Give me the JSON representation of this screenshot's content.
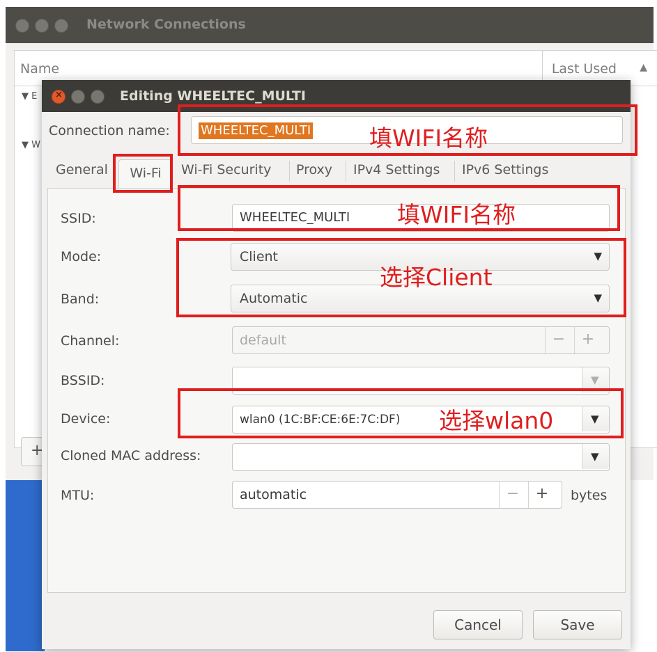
{
  "bg_window": {
    "title": "Network Connections",
    "col_name": "Name",
    "col_last_used": "Last Used",
    "sort_icon": "sort-ascending-icon",
    "group1_initial": "E",
    "group2_initial": "W",
    "add_label": "+"
  },
  "dialog": {
    "title": "Editing WHEELTEC_MULTI",
    "connection_name_label": "Connection name:",
    "connection_name_value": "WHEELTEC_MULTI",
    "tabs": [
      {
        "label": "General"
      },
      {
        "label": "Wi-Fi"
      },
      {
        "label": "Wi-Fi Security"
      },
      {
        "label": "Proxy"
      },
      {
        "label": "IPv4 Settings"
      },
      {
        "label": "IPv6 Settings"
      }
    ],
    "active_tab": "Wi-Fi",
    "fields": {
      "ssid_label": "SSID:",
      "ssid_value": "WHEELTEC_MULTI",
      "mode_label": "Mode:",
      "mode_value": "Client",
      "band_label": "Band:",
      "band_value": "Automatic",
      "channel_label": "Channel:",
      "channel_value": "default",
      "bssid_label": "BSSID:",
      "bssid_value": "",
      "device_label": "Device:",
      "device_value": "wlan0 (1C:BF:CE:6E:7C:DF)",
      "cloned_mac_label": "Cloned MAC address:",
      "cloned_mac_value": "",
      "mtu_label": "MTU:",
      "mtu_value": "automatic",
      "mtu_unit": "bytes",
      "minus": "−",
      "plus": "+"
    },
    "buttons": {
      "cancel": "Cancel",
      "save": "Save"
    }
  },
  "annotations": {
    "name1": "填WIFI名称",
    "name2": "填WIFI名称",
    "client": "选择Client",
    "wlan0": "选择wlan0",
    "color": "#e01e1e"
  },
  "colors": {
    "titlebar": "#3c3b37",
    "close_button": "#e05a2b",
    "selection": "#e0761f",
    "window_bg": "#f2f1f0"
  }
}
